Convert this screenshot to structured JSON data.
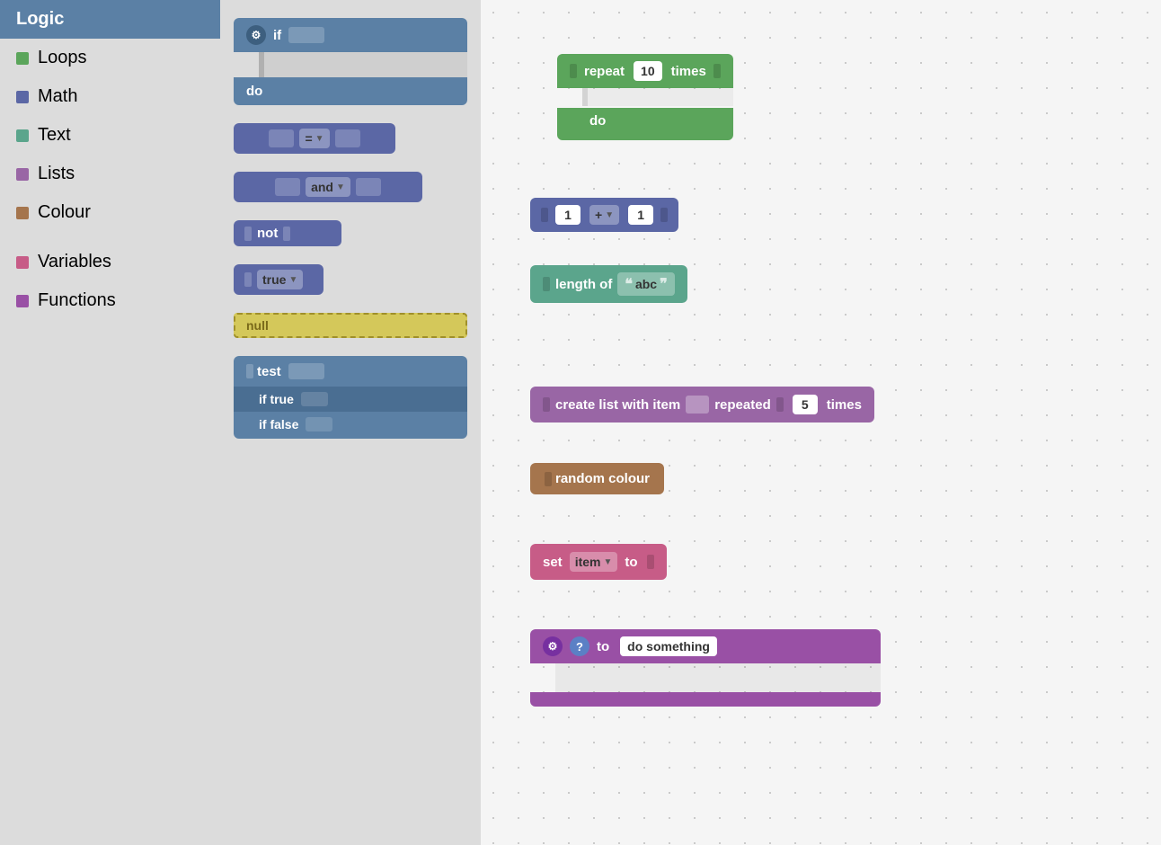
{
  "sidebar": {
    "items": [
      {
        "label": "Logic",
        "color": null,
        "active": true
      },
      {
        "label": "Loops",
        "color": "#5ba55b"
      },
      {
        "label": "Math",
        "color": "#5b67a5"
      },
      {
        "label": "Text",
        "color": "#5ba58c"
      },
      {
        "label": "Lists",
        "color": "#9966a5"
      },
      {
        "label": "Colour",
        "color": "#a5754d"
      },
      {
        "label": "",
        "color": null
      },
      {
        "label": "Variables",
        "color": "#c75c87"
      },
      {
        "label": "Functions",
        "color": "#9950a5"
      }
    ]
  },
  "blocks_panel": {
    "if_block": {
      "label": "if",
      "sub": "do"
    },
    "equals_block": {
      "op": "="
    },
    "and_block": {
      "op": "and"
    },
    "not_block": {
      "label": "not"
    },
    "true_block": {
      "label": "true"
    },
    "null_block": {
      "label": "null"
    },
    "ternary_block": {
      "line1": "test",
      "line2": "if true",
      "line3": "if false"
    }
  },
  "workspace": {
    "repeat_block": {
      "label": "repeat",
      "times_label": "times",
      "value": "10",
      "do_label": "do"
    },
    "math_block": {
      "val1": "1",
      "op": "+",
      "val2": "1"
    },
    "length_block": {
      "label": "length of",
      "value": "abc"
    },
    "list_block": {
      "label": "create list with item",
      "repeated": "repeated",
      "times_label": "times",
      "value": "5"
    },
    "colour_block": {
      "label": "random colour"
    },
    "variable_block": {
      "label": "set",
      "var_name": "item",
      "to_label": "to"
    },
    "function_block": {
      "to_label": "to",
      "name": "do something"
    }
  }
}
